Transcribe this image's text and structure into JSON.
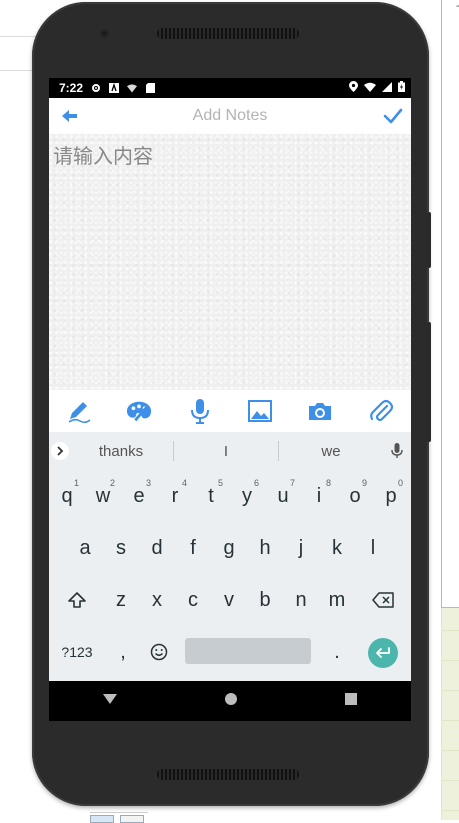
{
  "status_bar": {
    "time": "7:22"
  },
  "toolbar": {
    "title": "Add Notes"
  },
  "editor": {
    "placeholder": "请输入内容"
  },
  "suggestions": [
    "thanks",
    "I",
    "we"
  ],
  "keyboard": {
    "row1": [
      {
        "k": "q",
        "n": "1"
      },
      {
        "k": "w",
        "n": "2"
      },
      {
        "k": "e",
        "n": "3"
      },
      {
        "k": "r",
        "n": "4"
      },
      {
        "k": "t",
        "n": "5"
      },
      {
        "k": "y",
        "n": "6"
      },
      {
        "k": "u",
        "n": "7"
      },
      {
        "k": "i",
        "n": "8"
      },
      {
        "k": "o",
        "n": "9"
      },
      {
        "k": "p",
        "n": "0"
      }
    ],
    "row2": [
      "a",
      "s",
      "d",
      "f",
      "g",
      "h",
      "j",
      "k",
      "l"
    ],
    "row3": [
      "z",
      "x",
      "c",
      "v",
      "b",
      "n",
      "m"
    ],
    "symbols_label": "?123",
    "comma": ",",
    "period": "."
  },
  "colors": {
    "accent": "#3d8fe8",
    "enter": "#4db6ac"
  },
  "icons": {
    "toolbar": [
      "back-arrow-icon",
      "check-icon"
    ],
    "editor_tools": [
      "pen-icon",
      "palette-icon",
      "mic-icon",
      "image-icon",
      "camera-icon",
      "attachment-icon"
    ],
    "navigation": [
      "nav-back-icon",
      "nav-home-icon",
      "nav-recents-icon"
    ]
  }
}
